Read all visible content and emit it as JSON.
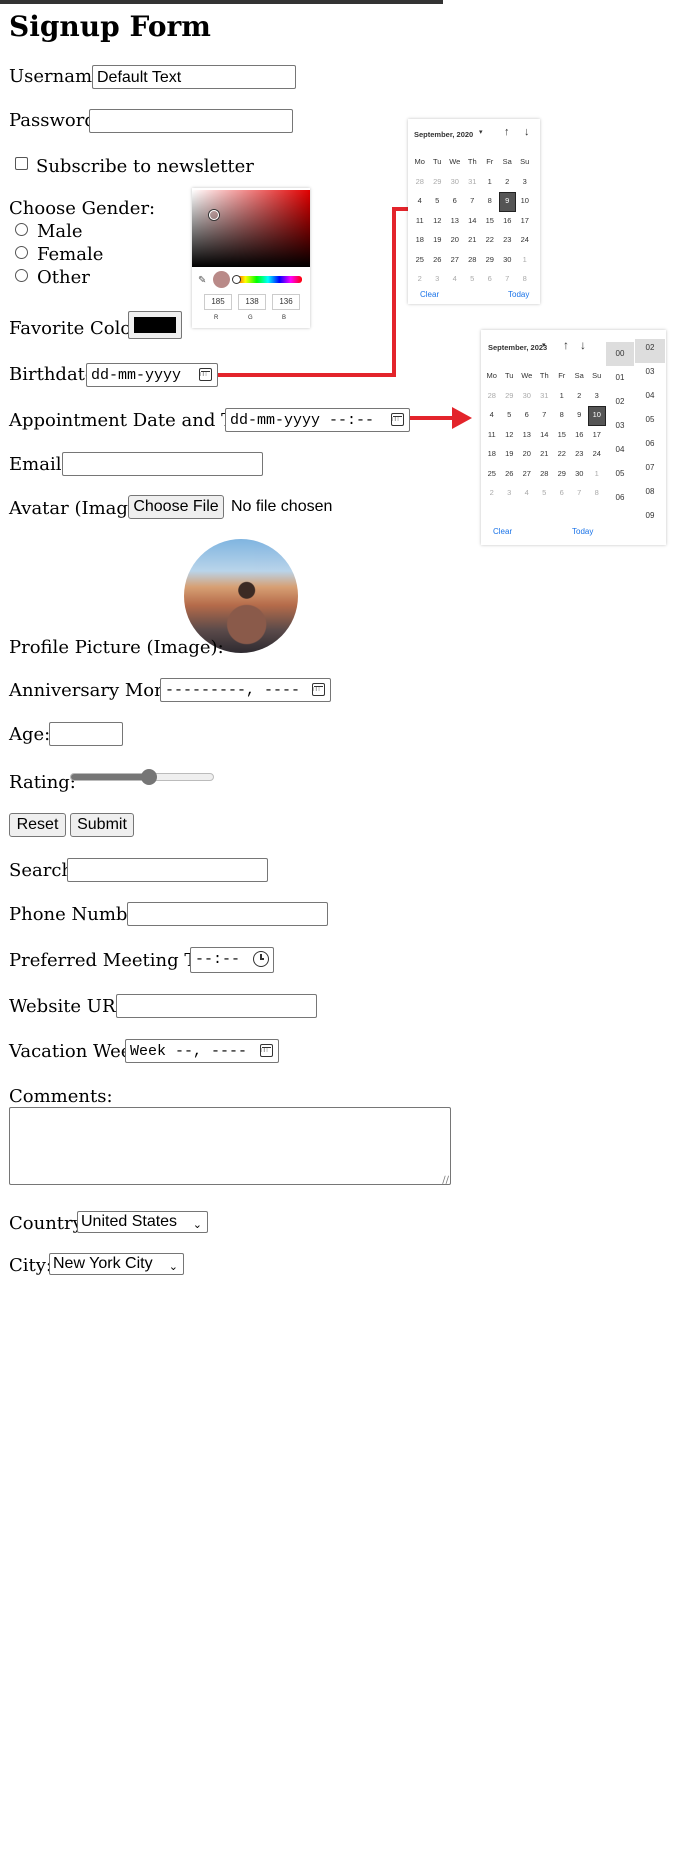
{
  "form": {
    "title": "Signup Form",
    "username_label": "Username:",
    "username_value": "Default Text",
    "password_label": "Password:",
    "subscribe_label": "Subscribe to newsletter",
    "gender_label": "Choose Gender:",
    "gender_options": [
      "Male",
      "Female",
      "Other"
    ],
    "favorite_color_label": "Favorite Color:",
    "favorite_color_value": "#000000",
    "birthdate_label": "Birthdate:",
    "birthdate_placeholder": "dd-mm-yyyy",
    "appointment_label": "Appointment Date and Time:",
    "appointment_placeholder": "dd-mm-yyyy --:--",
    "email_label": "Email:",
    "avatar_label": "Avatar (Image):",
    "avatar_button": "Choose File",
    "avatar_status": "No file chosen",
    "profile_label": "Profile Picture (Image):",
    "anniversary_label": "Anniversary Month:",
    "anniversary_placeholder": "---------, ----",
    "age_label": "Age:",
    "rating_label": "Rating:",
    "rating_value_fraction": 0.55,
    "reset_button": "Reset",
    "submit_button": "Submit",
    "search_label": "Search:",
    "phone_label": "Phone Number:",
    "meeting_label": "Preferred Meeting Time:",
    "meeting_placeholder": "--:--",
    "website_label": "Website URL:",
    "vacation_label": "Vacation Week:",
    "vacation_placeholder": "Week --, ----",
    "comments_label": "Comments:",
    "country_label": "Country:",
    "country_value": "United States",
    "city_label": "City:",
    "city_value": "New York City"
  },
  "color_picker": {
    "r": "185",
    "g": "138",
    "b": "136",
    "r_label": "R",
    "g_label": "G",
    "b_label": "B"
  },
  "calendar1": {
    "month": "September, 2020",
    "weekdays": [
      "Mo",
      "Tu",
      "We",
      "Th",
      "Fr",
      "Sa",
      "Su"
    ],
    "days": [
      "28",
      "29",
      "30",
      "31",
      "1",
      "2",
      "3",
      "4",
      "5",
      "6",
      "7",
      "8",
      "9",
      "10",
      "11",
      "12",
      "13",
      "14",
      "15",
      "16",
      "17",
      "18",
      "19",
      "20",
      "21",
      "22",
      "23",
      "24",
      "25",
      "26",
      "27",
      "28",
      "29",
      "30",
      "1",
      "2",
      "3",
      "4",
      "5",
      "6",
      "7",
      "8"
    ],
    "selected": "9",
    "clear": "Clear",
    "today": "Today"
  },
  "calendar2": {
    "month": "September, 2023",
    "weekdays": [
      "Mo",
      "Tu",
      "We",
      "Th",
      "Fr",
      "Sa",
      "Su"
    ],
    "days": [
      "28",
      "29",
      "30",
      "31",
      "1",
      "2",
      "3",
      "4",
      "5",
      "6",
      "7",
      "8",
      "9",
      "10",
      "11",
      "12",
      "13",
      "14",
      "15",
      "16",
      "17",
      "18",
      "19",
      "20",
      "21",
      "22",
      "23",
      "24",
      "25",
      "26",
      "27",
      "28",
      "29",
      "30",
      "1",
      "2",
      "3",
      "4",
      "5",
      "6",
      "7",
      "8"
    ],
    "selected": "10",
    "clear": "Clear",
    "today": "Today",
    "hours": [
      "00",
      "01",
      "02",
      "03",
      "04",
      "05",
      "06"
    ],
    "minutes": [
      "02",
      "03",
      "04",
      "05",
      "06",
      "07",
      "08",
      "09"
    ]
  },
  "colors": {
    "arrow": "#e3242b",
    "link_blue": "#1a73e8"
  }
}
